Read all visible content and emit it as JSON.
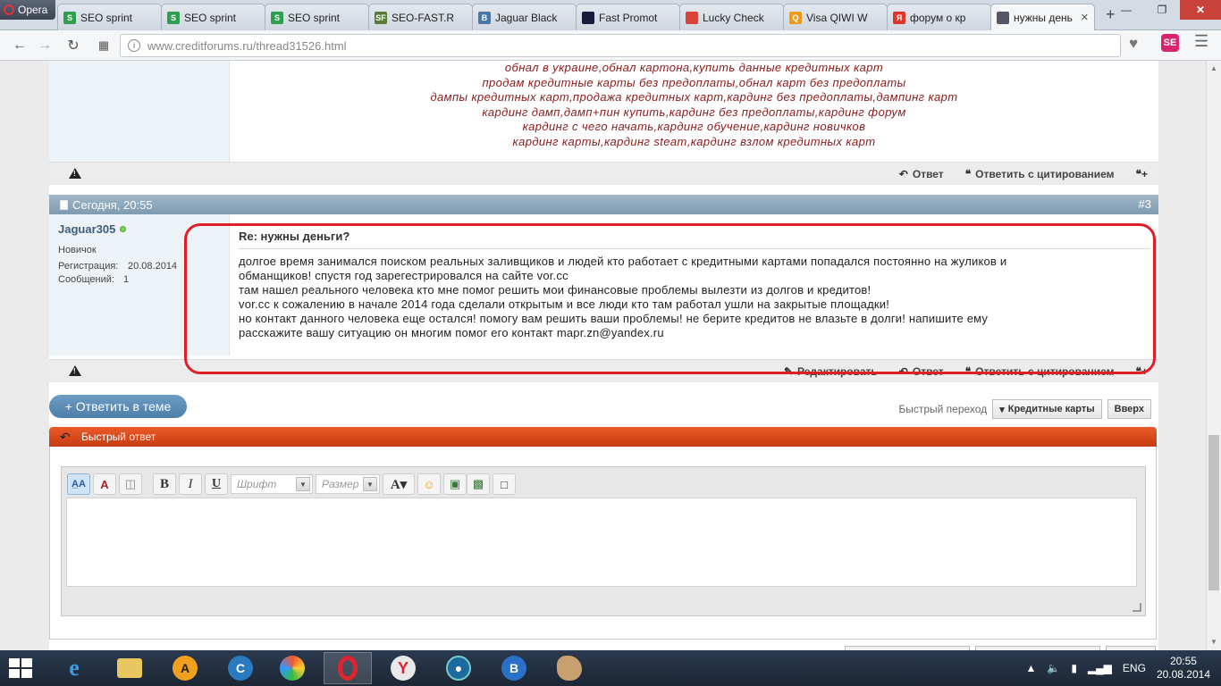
{
  "browser": {
    "menu_label": "Opera",
    "tabs": [
      {
        "label": "SEO sprint",
        "favicon": "S",
        "color": "#2e9e4f"
      },
      {
        "label": "SEO sprint",
        "favicon": "S",
        "color": "#2e9e4f"
      },
      {
        "label": "SEO sprint",
        "favicon": "S",
        "color": "#2e9e4f"
      },
      {
        "label": "SEO-FAST.R",
        "favicon": "SF",
        "color": "#5a7a3a"
      },
      {
        "label": "Jaguar Black",
        "favicon": "B",
        "color": "#4a76a8"
      },
      {
        "label": "Fast Promot",
        "favicon": "",
        "color": "#1a1a3a"
      },
      {
        "label": "Lucky Check",
        "favicon": "",
        "color": "#d9433a"
      },
      {
        "label": "Visa QIWI W",
        "favicon": "Q",
        "color": "#f09a1a"
      },
      {
        "label": "форум о кр",
        "favicon": "Я",
        "color": "#e0342a"
      },
      {
        "label": "нужны день",
        "favicon": "",
        "color": "#556"
      }
    ],
    "url_domain": "www.creditforums.ru",
    "url_path": "/thread31526.html",
    "ext_label": "SE"
  },
  "prev_post": {
    "signature_lines": [
      "обнал в украине,обнал картона,купить данные кредитных карт",
      "продам кредитные карты без предоплаты,обнал карт без предоплаты",
      "дампы кредитных карт,продажа кредитных карт,кардинг без предоплаты,дампинг карт",
      "кардинг дамп,дамп+пин купить,кардинг без предоплаты,кардинг форум",
      "кардинг с чего начать,кардинг обучение,кардинг новичков",
      "кардинг карты,кардинг steam,кардинг взлом кредитных карт"
    ],
    "reply_label": "Ответ",
    "quote_label": "Ответить с цитированием"
  },
  "post": {
    "date": "Сегодня, 20:55",
    "number": "#3",
    "author": "Jaguar305",
    "rank": "Новичок",
    "reg_label": "Регистрация:",
    "reg_value": "20.08.2014",
    "msgs_label": "Сообщений:",
    "msgs_value": "1",
    "title": "Re: нужны деньги?",
    "body_lines": [
      "долгое время занимался поиском реальных заливщиков и людей кто работает с кредитными картами попадался постоянно на жуликов и",
      "обманщиков! спустя год зарегестрировался на сайте vor.cc",
      "там нашел реального человека кто мне помог решить мои финансовые проблемы вылезти из долгов и кредитов!",
      "vor.cc к сожалению в начале 2014 года сделали открытым и все люди кто там работал ушли на закрытые площадки!",
      "но контакт данного человека еще остался! помогу вам решить ваши проблемы! не берите кредитов не влазьте в долги! напишите ему",
      "расскажите вашу ситуацию он многим помог его контакт mapr.zn@yandex.ru"
    ],
    "edit_label": "Редактировать",
    "reply_label": "Ответ",
    "quote_label": "Ответить с цитированием"
  },
  "thread": {
    "reply_button": "+ Ответить в теме",
    "quick_nav_label": "Быстрый переход",
    "quick_nav_value": "Кредитные карты",
    "top_button": "Вверх"
  },
  "quick_reply": {
    "title": "Быстрый ответ",
    "font_placeholder": "Шрифт",
    "size_placeholder": "Размер"
  },
  "taskbar": {
    "lang": "ENG",
    "time": "20:55",
    "date": "20.08.2014"
  }
}
